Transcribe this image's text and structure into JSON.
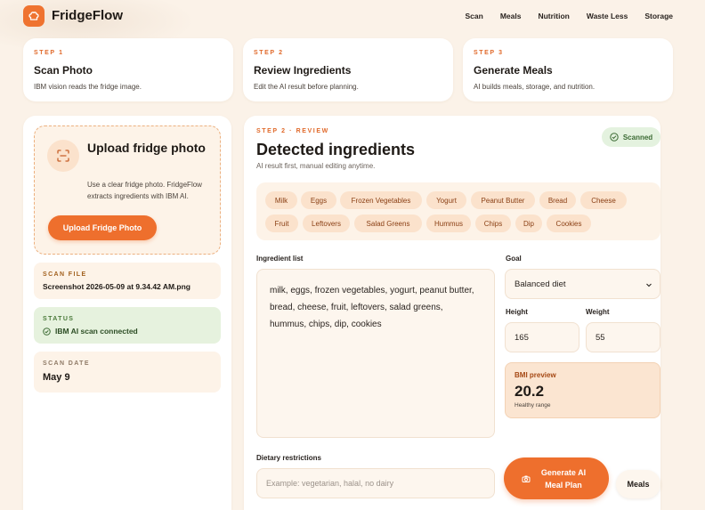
{
  "brand": {
    "name": "FridgeFlow",
    "logo_icon": "chef-hat-icon"
  },
  "nav": [
    "Scan",
    "Meals",
    "Nutrition",
    "Waste Less",
    "Storage"
  ],
  "steps": [
    {
      "kicker": "STEP 1",
      "title": "Scan Photo",
      "desc": "IBM vision reads the fridge image."
    },
    {
      "kicker": "STEP 2",
      "title": "Review Ingredients",
      "desc": "Edit the AI result before planning."
    },
    {
      "kicker": "STEP 3",
      "title": "Generate Meals",
      "desc": "AI builds meals, storage, and nutrition."
    }
  ],
  "upload": {
    "title": "Upload fridge photo",
    "desc": "Use a clear fridge photo. FridgeFlow extracts ingredients with IBM AI.",
    "button": "Upload Fridge Photo"
  },
  "scan_file": {
    "kicker": "SCAN FILE",
    "value": "Screenshot 2026-05-09 at 9.34.42 AM.png"
  },
  "status": {
    "kicker": "STATUS",
    "value": "IBM AI scan connected"
  },
  "scan_date": {
    "kicker": "SCAN DATE",
    "value": "May 9"
  },
  "review": {
    "kicker": "STEP 2 · REVIEW",
    "title": "Detected ingredients",
    "subtitle": "AI result first, manual editing anytime.",
    "badge": "Scanned"
  },
  "chips": [
    "Milk",
    "Eggs",
    "Frozen Vegetables",
    "Yogurt",
    "Peanut Butter",
    "Bread",
    "Cheese",
    "Fruit",
    "Leftovers",
    "Salad Greens",
    "Hummus",
    "Chips",
    "Dip",
    "Cookies"
  ],
  "ingredient_list": {
    "label": "Ingredient list",
    "value": "milk, eggs, frozen vegetables, yogurt, peanut butter, bread, cheese, fruit, leftovers, salad greens, hummus, chips, dip, cookies"
  },
  "goal": {
    "label": "Goal",
    "value": "Balanced diet"
  },
  "height": {
    "label": "Height",
    "value": "165"
  },
  "weight": {
    "label": "Weight",
    "value": "55"
  },
  "bmi": {
    "label": "BMI preview",
    "value": "20.2",
    "note": "Healthy range"
  },
  "dietary": {
    "label": "Dietary restrictions",
    "placeholder": "Example: vegetarian, halal, no dairy"
  },
  "actions": {
    "generate": "Generate AI Meal Plan",
    "meals": "Meals"
  },
  "colors": {
    "accent": "#ee6f2d",
    "background": "#fbf2e8",
    "chip": "#fbe2cc",
    "success": "#3c6b34"
  }
}
